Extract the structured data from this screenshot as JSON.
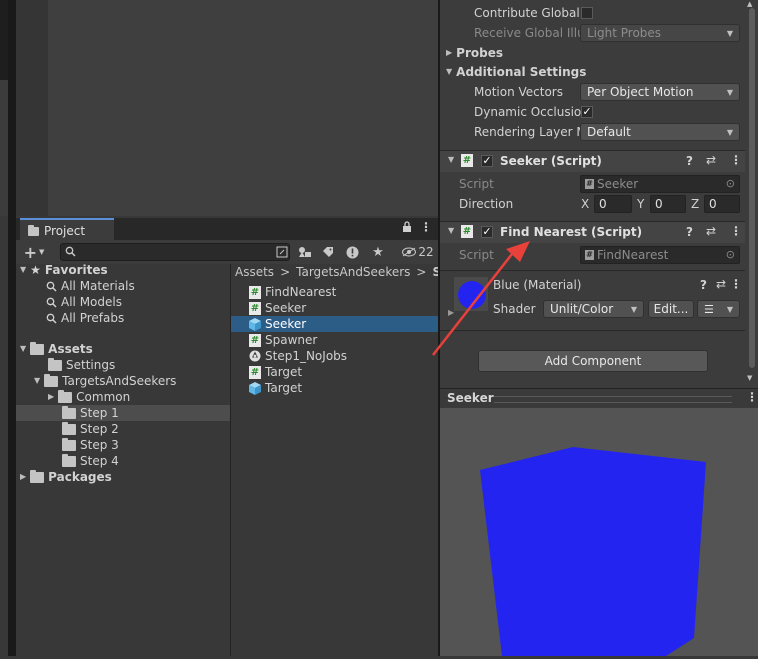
{
  "project_window": {
    "tab_label": "Project",
    "visible_count": "22",
    "breadcrumb": [
      "Assets",
      "TargetsAndSeekers",
      "Ste"
    ],
    "favorites": {
      "label": "Favorites",
      "items": [
        "All Materials",
        "All Models",
        "All Prefabs"
      ]
    },
    "assets": {
      "label": "Assets",
      "children": [
        "Settings",
        "TargetsAndSeekers"
      ],
      "targets_children": [
        "Common",
        "Step 1",
        "Step 2",
        "Step 3",
        "Step 4"
      ]
    },
    "packages_label": "Packages",
    "files": [
      {
        "name": "FindNearest",
        "icon": "script-icon"
      },
      {
        "name": "Seeker",
        "icon": "script-icon"
      },
      {
        "name": "Seeker",
        "icon": "prefab-cube-icon",
        "selected": true
      },
      {
        "name": "Spawner",
        "icon": "script-icon"
      },
      {
        "name": "Step1_NoJobs",
        "icon": "unity-scene-icon"
      },
      {
        "name": "Target",
        "icon": "script-icon"
      },
      {
        "name": "Target",
        "icon": "prefab-cube-icon"
      }
    ]
  },
  "inspector": {
    "contribute_global": "Contribute Global",
    "receive_global": "Receive Global Illu",
    "receive_global_value": "Light Probes",
    "probes": "Probes",
    "additional_settings": "Additional Settings",
    "motion_vectors": "Motion Vectors",
    "motion_vectors_value": "Per Object Motion",
    "dynamic_occlusion": "Dynamic Occlusion",
    "rendering_layer": "Rendering Layer M",
    "rendering_layer_value": "Default",
    "seeker_component": {
      "title": "Seeker (Script)",
      "script_label": "Script",
      "script_value": "Seeker",
      "direction_label": "Direction",
      "x_label": "X",
      "x_value": "0",
      "y_label": "Y",
      "y_value": "0",
      "z_label": "Z",
      "z_value": "0"
    },
    "find_nearest_component": {
      "title": "Find Nearest (Script)",
      "script_label": "Script",
      "script_value": "FindNearest"
    },
    "material": {
      "name": "Blue (Material)",
      "shader_label": "Shader",
      "shader_value": "Unlit/Color",
      "edit_button": "Edit..."
    },
    "add_component": "Add Component"
  },
  "preview": {
    "title": "Seeker",
    "cube_color": "#2424f0"
  },
  "colors": {
    "selection_blue": "#2c5d87",
    "annotation_arrow": "#e8403a"
  }
}
